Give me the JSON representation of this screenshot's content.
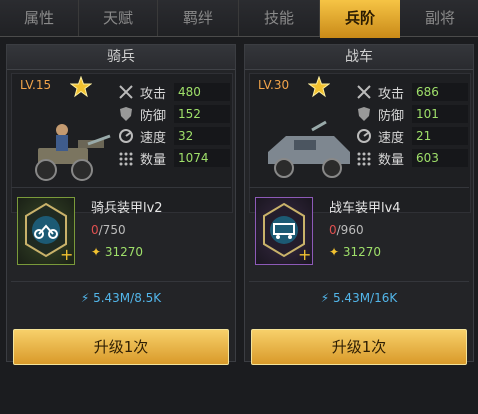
{
  "tabs": [
    "属性",
    "天赋",
    "羁绊",
    "技能",
    "兵阶",
    "副将"
  ],
  "active_tab_index": 4,
  "colors": {
    "accent": "#f6c445",
    "stat_value": "#9fe06a",
    "zero_count": "#e05050",
    "cost_blue": "#52b6ea",
    "item_border_green": "#7a9a3a",
    "item_border_purple": "#8d5ab8"
  },
  "panels": [
    {
      "title": "骑兵",
      "level": "LV.15",
      "unit_icon": "cavalry-vehicle-icon",
      "stats": [
        {
          "label": "攻击",
          "value": "480",
          "icon": "crossed-swords-icon"
        },
        {
          "label": "防御",
          "value": "152",
          "icon": "shield-icon"
        },
        {
          "label": "速度",
          "value": "32",
          "icon": "speed-icon"
        },
        {
          "label": "数量",
          "value": "1074",
          "icon": "troop-dots-icon"
        }
      ],
      "item": {
        "name": "骑兵装甲lv2",
        "current": "0",
        "total": "/750",
        "cost": "31270",
        "icon": "motorcycle-icon",
        "rarity": "green"
      },
      "cost_line": "5.43M/8.5K",
      "button": "升级1次"
    },
    {
      "title": "战车",
      "level": "LV.30",
      "unit_icon": "armored-car-icon",
      "stats": [
        {
          "label": "攻击",
          "value": "686",
          "icon": "crossed-swords-icon"
        },
        {
          "label": "防御",
          "value": "101",
          "icon": "shield-icon"
        },
        {
          "label": "速度",
          "value": "21",
          "icon": "speed-icon"
        },
        {
          "label": "数量",
          "value": "603",
          "icon": "troop-dots-icon"
        }
      ],
      "item": {
        "name": "战车装甲lv4",
        "current": "0",
        "total": "/960",
        "cost": "31270",
        "icon": "truck-icon",
        "rarity": "purple"
      },
      "cost_line": "5.43M/16K",
      "button": "升级1次"
    }
  ]
}
